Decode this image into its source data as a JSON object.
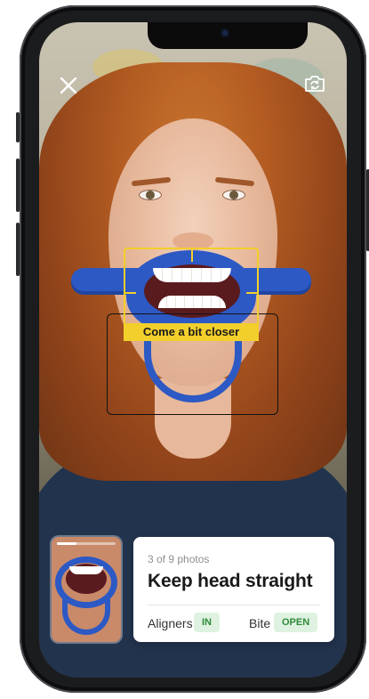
{
  "overlay": {
    "hint": "Come a bit closer"
  },
  "icons": {
    "close": "close-icon",
    "camera": "camera-switch-icon"
  },
  "progress": {
    "current": 3,
    "total": 9,
    "text": "3 of 9 photos",
    "fraction": 0.333
  },
  "card": {
    "title": "Keep head straight",
    "aligners_label": "Aligners",
    "aligners_value": "IN",
    "bite_label": "Bite",
    "bite_value": "OPEN"
  },
  "colors": {
    "guide": "#f3cf2b",
    "retractor": "#2d59c4",
    "badge_bg": "#dff2e1",
    "badge_text": "#2e8b3a"
  }
}
